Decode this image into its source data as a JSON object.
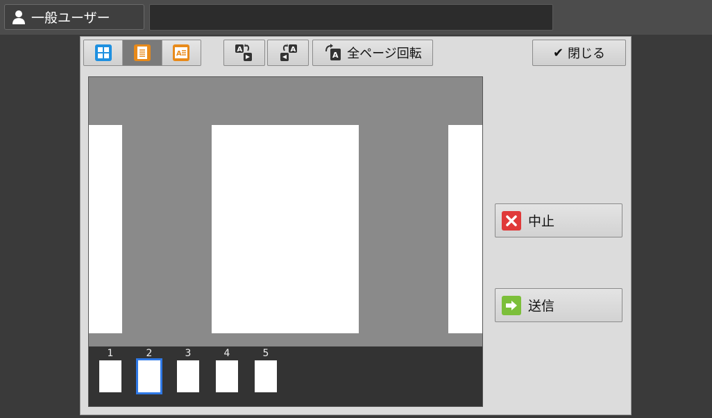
{
  "header": {
    "user_label": "一般ユーザー",
    "title_value": ""
  },
  "toolbar": {
    "rotate_all_label": "全ページ回転",
    "close_label": "閉じる"
  },
  "actions": {
    "cancel_label": "中止",
    "send_label": "送信"
  },
  "thumbnails": [
    "1",
    "2",
    "3",
    "4",
    "5"
  ],
  "selected_page": "2",
  "colors": {
    "accent_blue": "#2f79e6",
    "orange": "#e88a1a",
    "cancel_red": "#e03a3a",
    "send_green": "#7cbf3a"
  }
}
